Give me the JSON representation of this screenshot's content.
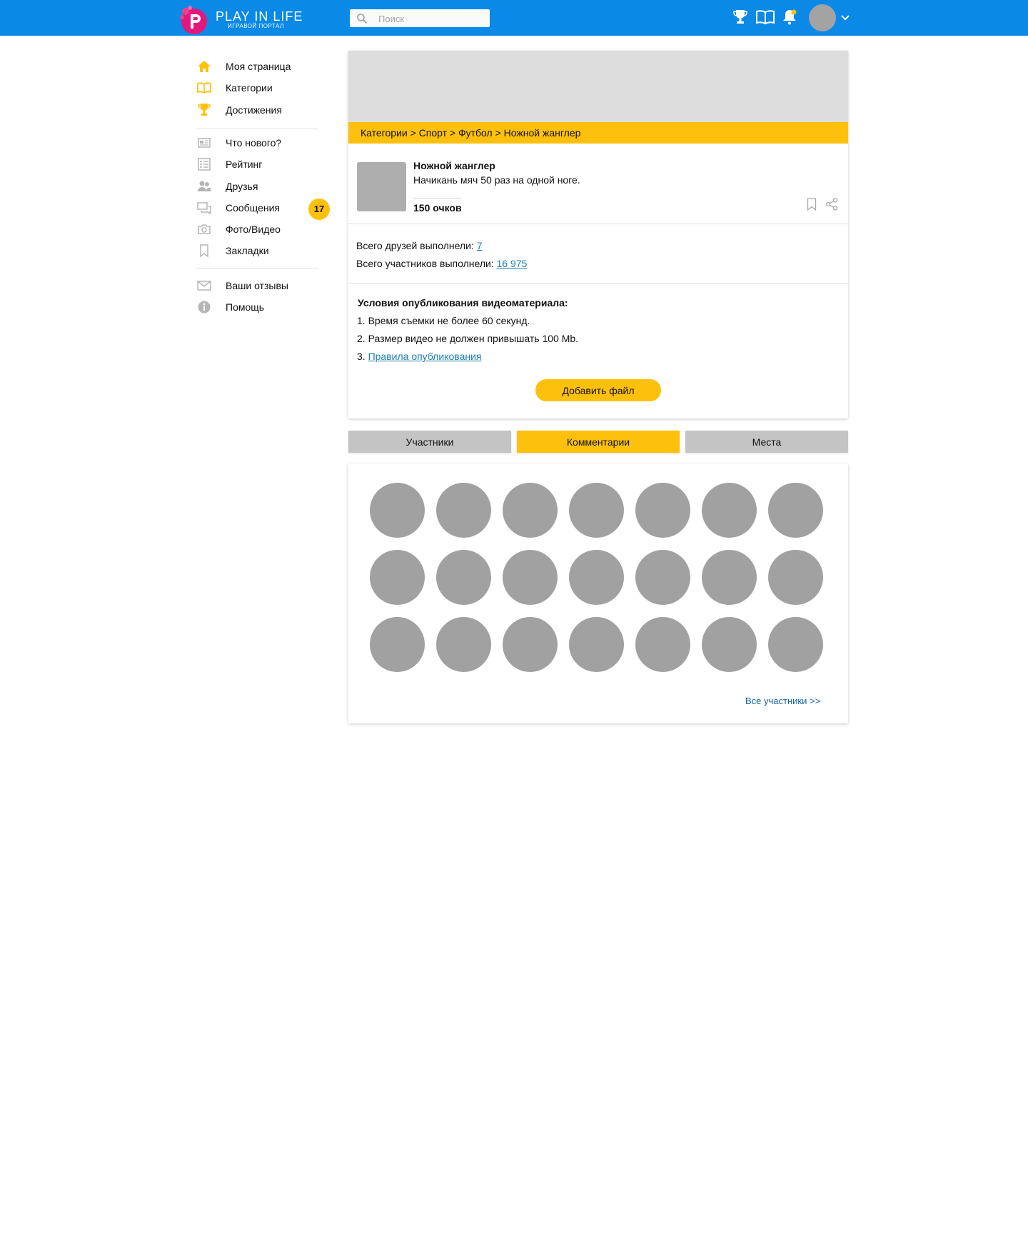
{
  "header": {
    "logo_title": "PLAY IN LIFE",
    "logo_subtitle": "ИГРАВОЙ ПОРТАЛ",
    "search_placeholder": "Поиск",
    "icons": [
      "trophy-icon",
      "book-icon",
      "bell-icon"
    ],
    "notification_dot": true
  },
  "sidebar": {
    "items": [
      {
        "label": "Моя страница",
        "icon": "home-icon"
      },
      {
        "label": "Категории",
        "icon": "book-icon"
      },
      {
        "label": "Достижения",
        "icon": "trophy-icon"
      },
      {
        "label": "Что нового?",
        "icon": "news-icon"
      },
      {
        "label": "Рейтинг",
        "icon": "rating-list-icon"
      },
      {
        "label": "Друзья",
        "icon": "friends-icon"
      },
      {
        "label": "Сообщения",
        "icon": "messages-icon",
        "badge": "17"
      },
      {
        "label": "Фото/Видео",
        "icon": "camera-icon"
      },
      {
        "label": "Закладки",
        "icon": "bookmark-icon"
      },
      {
        "label": "Ваши отзывы",
        "icon": "envelope-icon"
      },
      {
        "label": "Помощь",
        "icon": "info-icon"
      }
    ]
  },
  "task": {
    "breadcrumb": "Категории > Спорт > Футбол > Ножной жанглер",
    "title": "Ножной жанглер",
    "description": "Начикань мяч 50 раз на одной ноге.",
    "points": "150 очков",
    "friends_done_label": "Всего друзей выполнели: ",
    "friends_done_value": "7",
    "participants_done_label": "Всего участников выполнели: ",
    "participants_done_value": "16 975",
    "conditions_title": "Условия опубликования видеоматериала:",
    "conditions": [
      "1. Время съемки не более 60 секунд.",
      "2. Размер видео не должен привышать 100 Mb."
    ],
    "condition_link_prefix": "3. ",
    "condition_link": "Правила опубликования",
    "add_file_label": "Добавить файл"
  },
  "tabs": [
    {
      "label": "Участники",
      "active": false
    },
    {
      "label": "Комментарии",
      "active": true
    },
    {
      "label": "Места",
      "active": false
    }
  ],
  "participants": {
    "rows": 3,
    "per_row": 7,
    "all_link": "Все участники >>"
  },
  "colors": {
    "header_blue": "#0a89e6",
    "accent_yellow": "#fdc10d",
    "placeholder_gray": "#a1a1a1",
    "link_blue": "#1a7fb0"
  }
}
